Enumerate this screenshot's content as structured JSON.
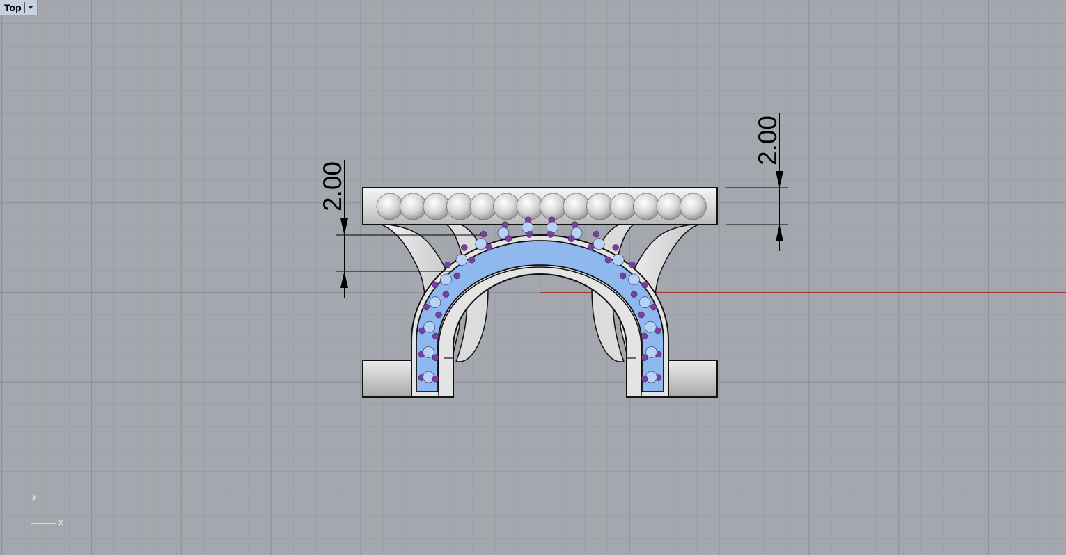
{
  "viewport": {
    "name": "Top",
    "menu_icon": "chevron-down-icon"
  },
  "dimensions": {
    "left_value": "2.00",
    "right_value": "2.00"
  },
  "axis_widget": {
    "x_label": "x",
    "y_label": "y"
  },
  "colors": {
    "background": "#a4a8ae",
    "grid_minor": "#9ca0a6",
    "grid_major": "#8c9096",
    "x_axis": "#a33a3a",
    "y_axis": "#2fa84a",
    "metal": "#e0e0e0",
    "gem_blue": "#8fb8ef",
    "gem_purple": "#7c3fa0"
  }
}
